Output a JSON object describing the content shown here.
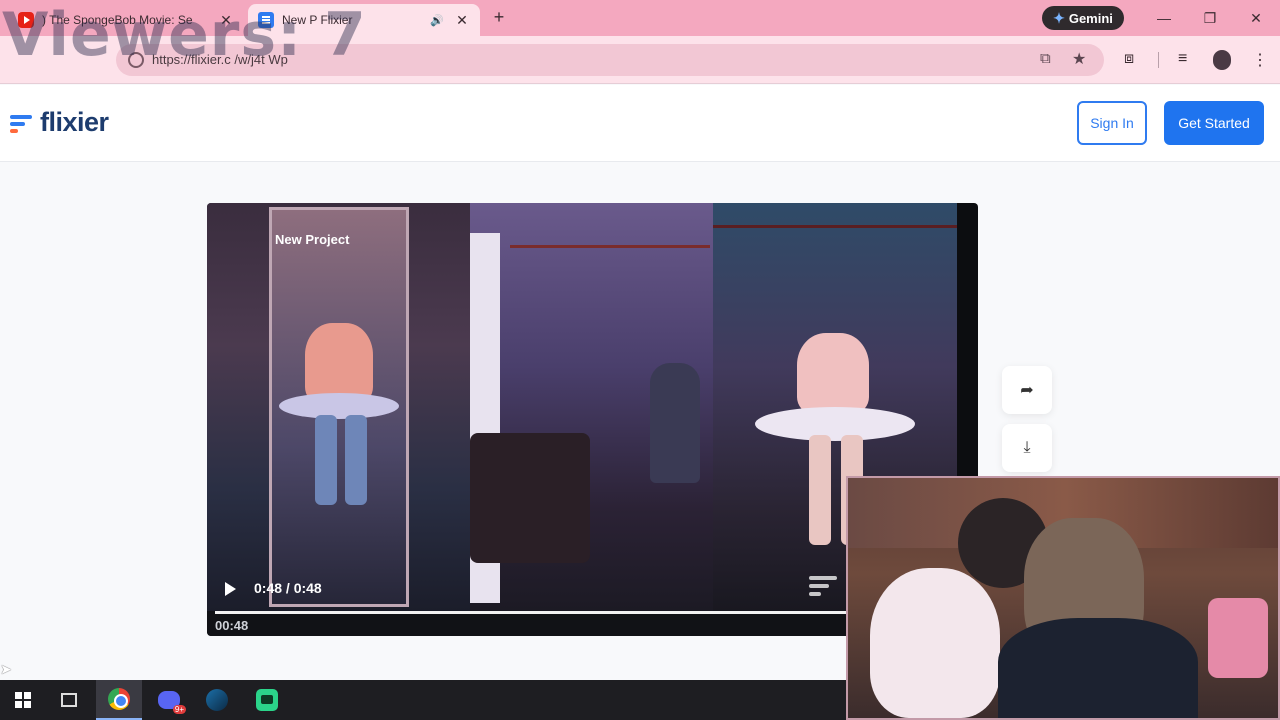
{
  "overlay": {
    "viewers_text": "Viewers: 7"
  },
  "browser": {
    "tabs": [
      {
        "title": ") The SpongeBob Movie: Se",
        "icon": "youtube-icon",
        "active": false
      },
      {
        "title": "New P   Flixier",
        "icon": "flixier-favicon-icon",
        "active": true,
        "audio": "🔊"
      }
    ],
    "close_glyph": "✕",
    "new_tab_glyph": "+",
    "gemini_label": "Gemini",
    "url": "https://flixier.c   /w/j4t  Wp",
    "window_controls": {
      "minimize": "—",
      "restore": "❐",
      "close": "✕"
    },
    "toolbar_icons": {
      "install": "⧉",
      "star": "★",
      "extensions": "⧈",
      "media": "≡",
      "menu": "⋮"
    }
  },
  "site": {
    "logo_text": "flixier",
    "signin_label": "Sign In",
    "get_started_label": "Get Started",
    "colors": {
      "brand_blue": "#1f74ef",
      "logo_accent": "#ff6a3d",
      "logo_text": "#1d3c6e"
    }
  },
  "player": {
    "project_title": "New Project",
    "current_time": "0:48 / 0:48",
    "timeline_time": "00:48",
    "progress": 1.0,
    "share_glyph": "➦",
    "download_glyph": "⤓"
  }
}
